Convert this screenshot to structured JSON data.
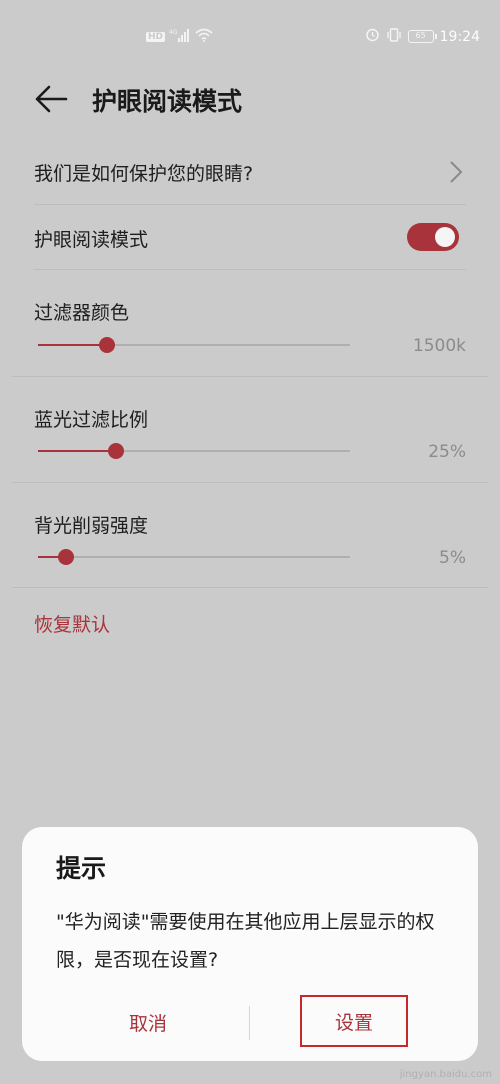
{
  "status_bar": {
    "hd_label": "HD",
    "network": "4G",
    "time": "19:24",
    "battery": "65"
  },
  "header": {
    "title": "护眼阅读模式"
  },
  "settings": {
    "how_protect": "我们是如何保护您的眼睛?",
    "eye_mode_label": "护眼阅读模式",
    "eye_mode_on": true,
    "sliders": [
      {
        "label": "过滤器颜色",
        "value_text": "1500k",
        "level": 0.22
      },
      {
        "label": "蓝光过滤比例",
        "value_text": "25%",
        "level": 0.25
      },
      {
        "label": "背光削弱强度",
        "value_text": "5%",
        "level": 0.09
      }
    ],
    "reset": "恢复默认"
  },
  "dialog": {
    "title": "提示",
    "message": "\"华为阅读\"需要使用在其他应用上层显示的权限，是否现在设置?",
    "cancel": "取消",
    "confirm": "设置"
  },
  "watermark": "jingyan.baidu.com",
  "colors": {
    "accent": "#a9333a",
    "background": "#cbcbcb",
    "dialog": "#fbfbfb"
  }
}
